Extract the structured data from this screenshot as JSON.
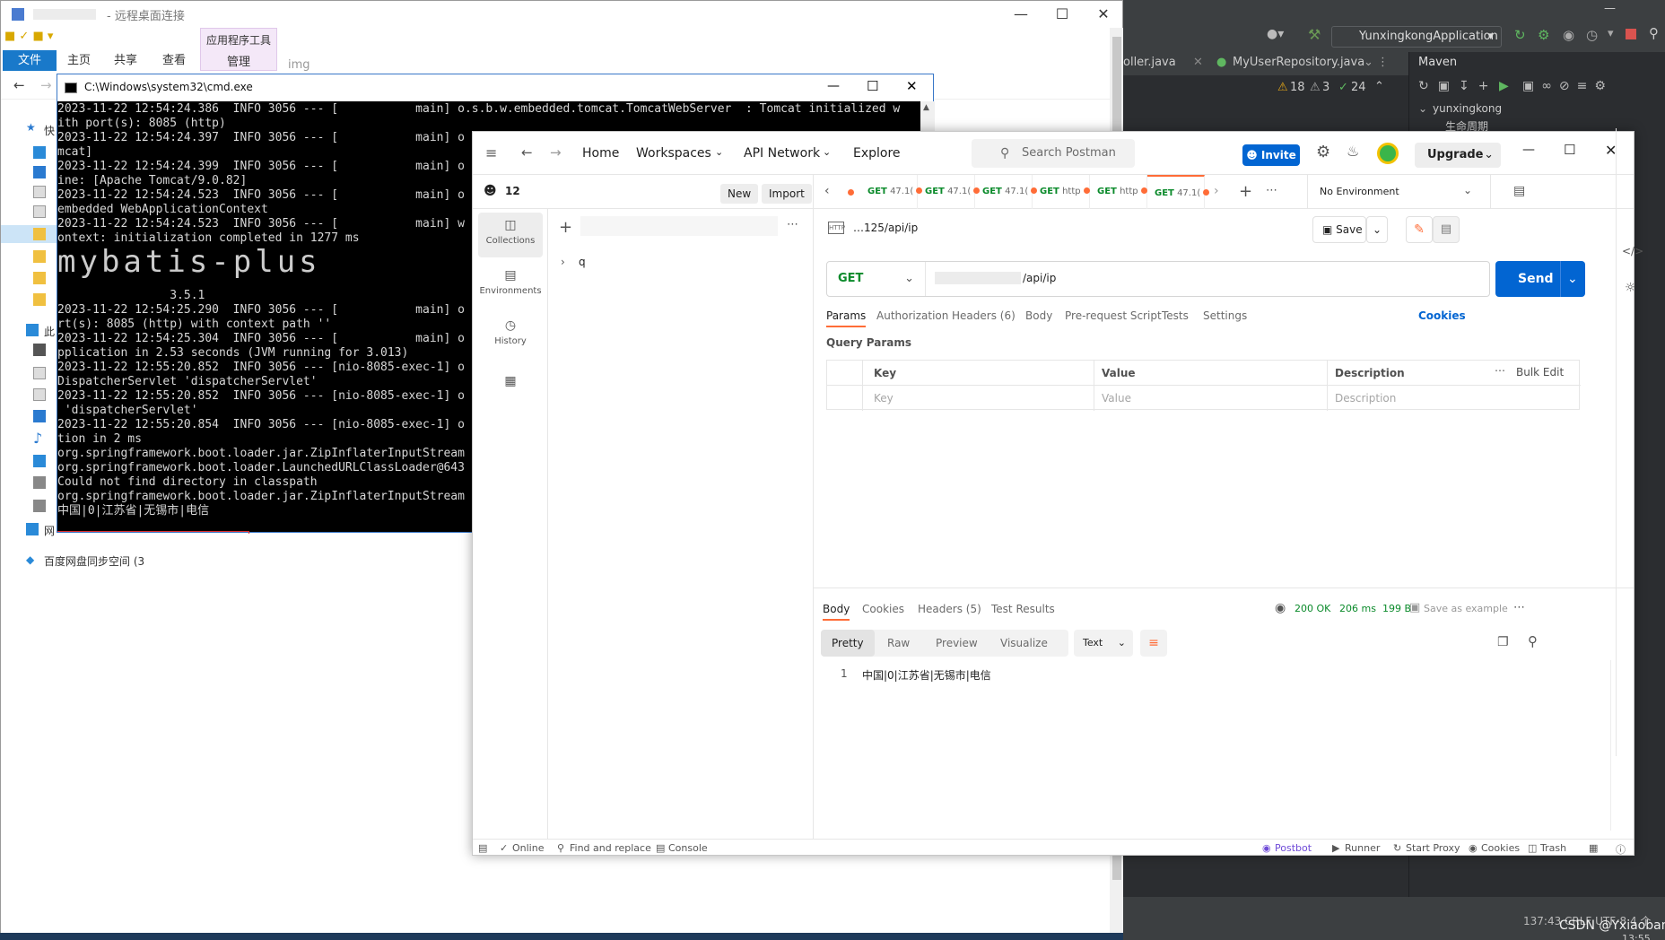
{
  "explorer": {
    "title": "- 远程桌面连接",
    "ribbon_tabs": [
      "文件",
      "主页",
      "共享",
      "查看"
    ],
    "context_tab_group": "应用程序工具",
    "context_tab": "管理",
    "folder_name": "img",
    "sidebar": [
      "快",
      "此",
      "网",
      "百度网盘同步空间 (3"
    ]
  },
  "cmd": {
    "title": "C:\\Windows\\system32\\cmd.exe",
    "lines": [
      "2023-11-22 12:54:24.386  INFO 3056 --- [           main] o.s.b.w.embedded.tomcat.TomcatWebServer  : Tomcat initialized w",
      "ith port(s): 8085 (http)",
      "2023-11-22 12:54:24.397  INFO 3056 --- [           main] o",
      "mcat]",
      "2023-11-22 12:54:24.399  INFO 3056 --- [           main] o",
      "ine: [Apache Tomcat/9.0.82]",
      "2023-11-22 12:54:24.523  INFO 3056 --- [           main] o",
      "embedded WebApplicationContext",
      "2023-11-22 12:54:24.523  INFO 3056 --- [           main] w",
      "ontext: initialization completed in 1277 ms",
      "",
      "",
      "",
      "                3.5.1",
      "2023-11-22 12:54:25.290  INFO 3056 --- [           main] o",
      "rt(s): 8085 (http) with context path ''",
      "2023-11-22 12:54:25.304  INFO 3056 --- [           main] o",
      "pplication in 2.53 seconds (JVM running for 3.013)",
      "2023-11-22 12:55:20.852  INFO 3056 --- [nio-8085-exec-1] o",
      "DispatcherServlet 'dispatcherServlet'",
      "2023-11-22 12:55:20.852  INFO 3056 --- [nio-8085-exec-1] o",
      " 'dispatcherServlet'",
      "2023-11-22 12:55:20.854  INFO 3056 --- [nio-8085-exec-1] o",
      "tion in 2 ms",
      "org.springframework.boot.loader.jar.ZipInflaterInputStream",
      "org.springframework.boot.loader.LaunchedURLClassLoader@643",
      "Could not find directory in classpath",
      "org.springframework.boot.loader.jar.ZipInflaterInputStream",
      "中国|0|江苏省|无锡市|电信"
    ],
    "banner": "mybatis-plus"
  },
  "idea": {
    "run_config": "YunxingkongApplication",
    "tabs": [
      "oller.java",
      "MyUserRepository.java"
    ],
    "inspections": {
      "warnings": "18",
      "weak": "3",
      "ok": "24"
    },
    "maven_title": "Maven",
    "maven_project": "yunxingkong",
    "maven_child": "生命周期",
    "status": "137:43  CRLF  UTF-8  4 个",
    "watermark": "CSDN @Yxiaoban",
    "time": "13:55"
  },
  "postman": {
    "nav": {
      "home": "Home",
      "workspaces": "Workspaces",
      "api_network": "API Network",
      "explore": "Explore"
    },
    "search_placeholder": "Search Postman",
    "invite": "Invite",
    "upgrade": "Upgrade",
    "workspace_user": "12",
    "new_btn": "New",
    "import_btn": "Import",
    "rail": [
      "Collections",
      "Environments",
      "History"
    ],
    "collection_item": "q",
    "request_tabs": [
      {
        "method": "GET",
        "name": "47.1("
      },
      {
        "method": "GET",
        "name": "47.1("
      },
      {
        "method": "GET",
        "name": "47.1("
      },
      {
        "method": "GET",
        "name": "http"
      },
      {
        "method": "GET",
        "name": "http"
      },
      {
        "method": "GET",
        "name": "47.1("
      }
    ],
    "environment": "No Environment",
    "request_name": "…125/api/ip",
    "save": "Save",
    "method": "GET",
    "url": "/api/ip",
    "send": "Send",
    "request_subtabs": [
      "Params",
      "Authorization",
      "Headers (6)",
      "Body",
      "Pre-request Script",
      "Tests",
      "Settings"
    ],
    "cookies": "Cookies",
    "query_params_title": "Query Params",
    "table_headers": [
      "Key",
      "Value",
      "Description"
    ],
    "bulk_edit": "Bulk Edit",
    "table_placeholders": [
      "Key",
      "Value",
      "Description"
    ],
    "response_tabs": [
      "Body",
      "Cookies",
      "Headers (5)",
      "Test Results"
    ],
    "status": "200 OK",
    "time": "206 ms",
    "size": "199 B",
    "save_example": "Save as example",
    "format_tabs": [
      "Pretty",
      "Raw",
      "Preview",
      "Visualize"
    ],
    "format_type": "Text",
    "response_line_no": "1",
    "response_line": "中国|0|江苏省|无锡市|电信",
    "footer": {
      "online": "Online",
      "find": "Find and replace",
      "console": "Console",
      "postbot": "Postbot",
      "runner": "Runner",
      "proxy": "Start Proxy",
      "cookies": "Cookies",
      "trash": "Trash"
    }
  }
}
